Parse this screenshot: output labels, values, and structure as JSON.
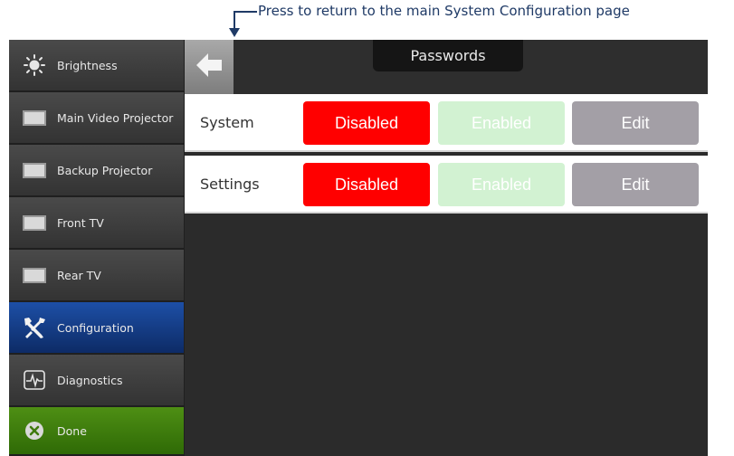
{
  "annotation": {
    "text": "Press to return to the main System Configuration page"
  },
  "sidebar": {
    "items": [
      {
        "label": "Brightness",
        "icon": "sun-icon"
      },
      {
        "label": "Main Video Projector",
        "icon": "display-icon"
      },
      {
        "label": "Backup Projector",
        "icon": "display-icon"
      },
      {
        "label": "Front TV",
        "icon": "display-icon"
      },
      {
        "label": "Rear TV",
        "icon": "display-icon"
      },
      {
        "label": "Configuration",
        "icon": "wrench-screwdriver-icon"
      },
      {
        "label": "Diagnostics",
        "icon": "waveform-icon"
      },
      {
        "label": "Done",
        "icon": "close-circle-icon"
      }
    ]
  },
  "header": {
    "title": "Passwords",
    "back_icon": "back-arrow-icon"
  },
  "rows": [
    {
      "label": "System",
      "disabled": "Disabled",
      "enabled": "Enabled",
      "edit": "Edit"
    },
    {
      "label": "Settings",
      "disabled": "Disabled",
      "enabled": "Enabled",
      "edit": "Edit"
    }
  ],
  "colors": {
    "active_blue": "#1d4fa6",
    "done_green": "#4e8f14",
    "disabled_red": "#ff0000",
    "enabled_green": "#d2f2d2",
    "edit_gray": "#a39fa6"
  }
}
